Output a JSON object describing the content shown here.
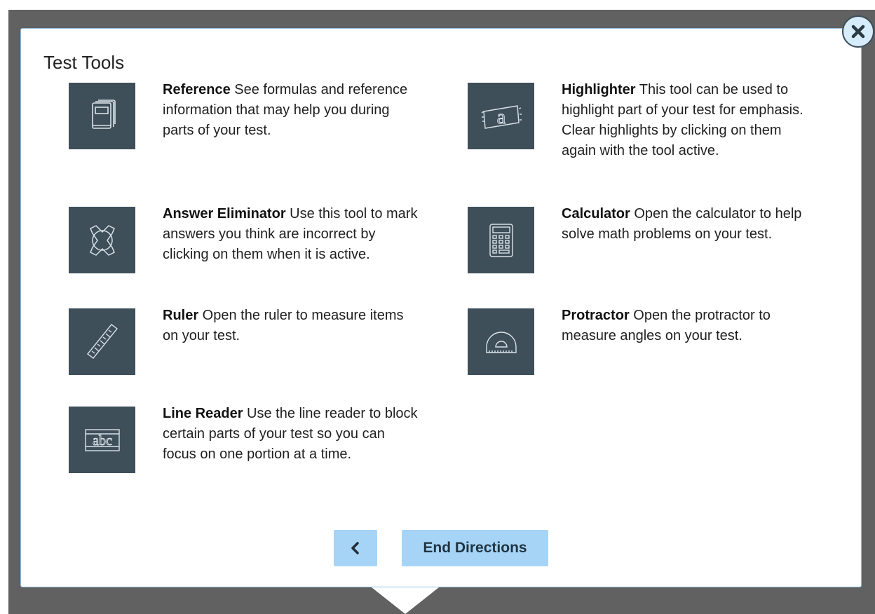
{
  "dialog": {
    "title": "Test Tools",
    "close_icon": "close-icon"
  },
  "tools": [
    {
      "name": "Reference",
      "description": " See formulas and reference information that may help you during parts of your test.",
      "icon": "book-icon"
    },
    {
      "name": "Highlighter",
      "description": " This tool can be used to highlight part of your test for emphasis. Clear highlights by clicking on them again with the tool active.",
      "icon": "highlighter-icon"
    },
    {
      "name": "Answer Eliminator",
      "description": " Use this tool to mark answers you think are incorrect by clicking on them when it is active.",
      "icon": "eliminator-icon"
    },
    {
      "name": "Calculator",
      "description": " Open the calculator to help solve math problems on your test.",
      "icon": "calculator-icon"
    },
    {
      "name": "Ruler",
      "description": " Open the ruler to measure items on your test.",
      "icon": "ruler-icon"
    },
    {
      "name": "Protractor",
      "description": " Open the protractor to measure angles on your test.",
      "icon": "protractor-icon"
    },
    {
      "name": "Line Reader",
      "description": " Use the line reader to block certain parts of your test so you can focus on one portion at a time.",
      "icon": "line-reader-icon"
    }
  ],
  "icon_glyphs": {
    "line_reader": "abc",
    "highlighter": "a"
  },
  "footer": {
    "back_icon": "chevron-left-icon",
    "end_label": "End Directions"
  },
  "colors": {
    "backdrop": "#616161",
    "icon_tile": "#3e4f5a",
    "button": "#a6d4f7",
    "close_bg": "#d7ecfb"
  }
}
